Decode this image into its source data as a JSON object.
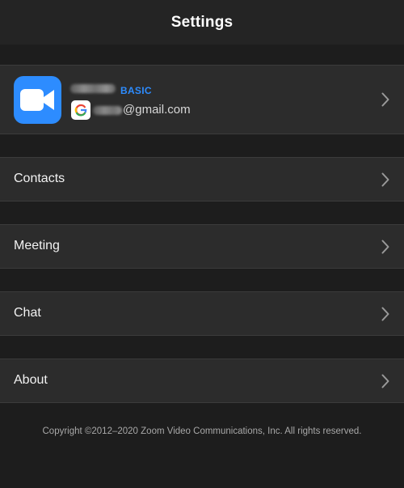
{
  "header": {
    "title": "Settings"
  },
  "profile": {
    "plan_badge": "BASIC",
    "email_suffix": "@gmail.com",
    "avatar_icon": "zoom-camera-icon",
    "account_icon": "google-icon",
    "brand_color": "#2d8cff"
  },
  "menu": {
    "contacts": "Contacts",
    "meeting": "Meeting",
    "chat": "Chat",
    "about": "About"
  },
  "footer": {
    "copyright": "Copyright ©2012–2020 Zoom Video Communications, Inc. All rights reserved."
  }
}
